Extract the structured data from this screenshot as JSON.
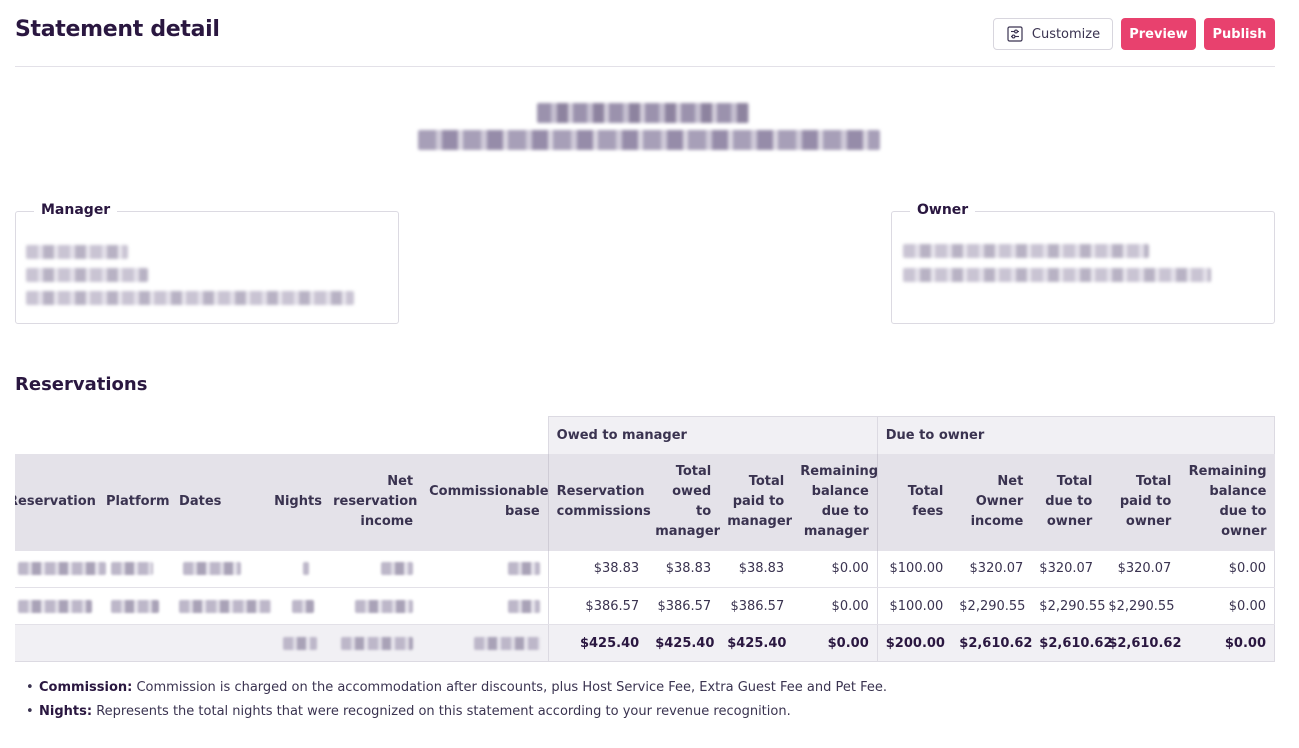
{
  "header": {
    "title": "Statement detail",
    "customize_label": "Customize",
    "preview_label": "Preview",
    "publish_label": "Publish",
    "customize_icon": "sliders-icon"
  },
  "manager": {
    "legend": "Manager"
  },
  "owner": {
    "legend": "Owner"
  },
  "reservations": {
    "title": "Reservations",
    "groups": {
      "owed_to_manager": "Owed to manager",
      "due_to_owner": "Due to owner"
    },
    "columns": {
      "reservation": "Reservation",
      "platform": "Platform",
      "dates": "Dates",
      "nights": "Nights",
      "net_income": "Net reservation income",
      "commissionable": "Commissionable base",
      "res_commissions": "Reservation commissions",
      "total_owed": "Total owed to manager",
      "total_paid_mgr": "Total paid to manager",
      "remaining_mgr": "Remaining balance due to manager",
      "total_fees": "Total fees",
      "net_owner": "Net Owner income",
      "total_due_owner": "Total due to owner",
      "total_paid_owner": "Total paid to owner",
      "remaining_owner": "Remaining balance due to owner"
    },
    "rows": [
      {
        "res_commissions": "$38.83",
        "total_owed": "$38.83",
        "total_paid_mgr": "$38.83",
        "remaining_mgr": "$0.00",
        "total_fees": "$100.00",
        "net_owner": "$320.07",
        "total_due_owner": "$320.07",
        "total_paid_owner": "$320.07",
        "remaining_owner": "$0.00"
      },
      {
        "res_commissions": "$386.57",
        "total_owed": "$386.57",
        "total_paid_mgr": "$386.57",
        "remaining_mgr": "$0.00",
        "total_fees": "$100.00",
        "net_owner": "$2,290.55",
        "total_due_owner": "$2,290.55",
        "total_paid_owner": "$2,290.55",
        "remaining_owner": "$0.00"
      }
    ],
    "totals": {
      "res_commissions": "$425.40",
      "total_owed": "$425.40",
      "total_paid_mgr": "$425.40",
      "remaining_mgr": "$0.00",
      "total_fees": "$200.00",
      "net_owner": "$2,610.62",
      "total_due_owner": "$2,610.62",
      "total_paid_owner": "$2,610.62",
      "remaining_owner": "$0.00"
    }
  },
  "notes": [
    {
      "term": "Commission:",
      "text": " Commission is charged on the accommodation after discounts, plus Host Service Fee, Extra Guest Fee and Pet Fee."
    },
    {
      "term": "Nights:",
      "text": " Represents the total nights that were recognized on this statement according to your revenue recognition."
    }
  ]
}
